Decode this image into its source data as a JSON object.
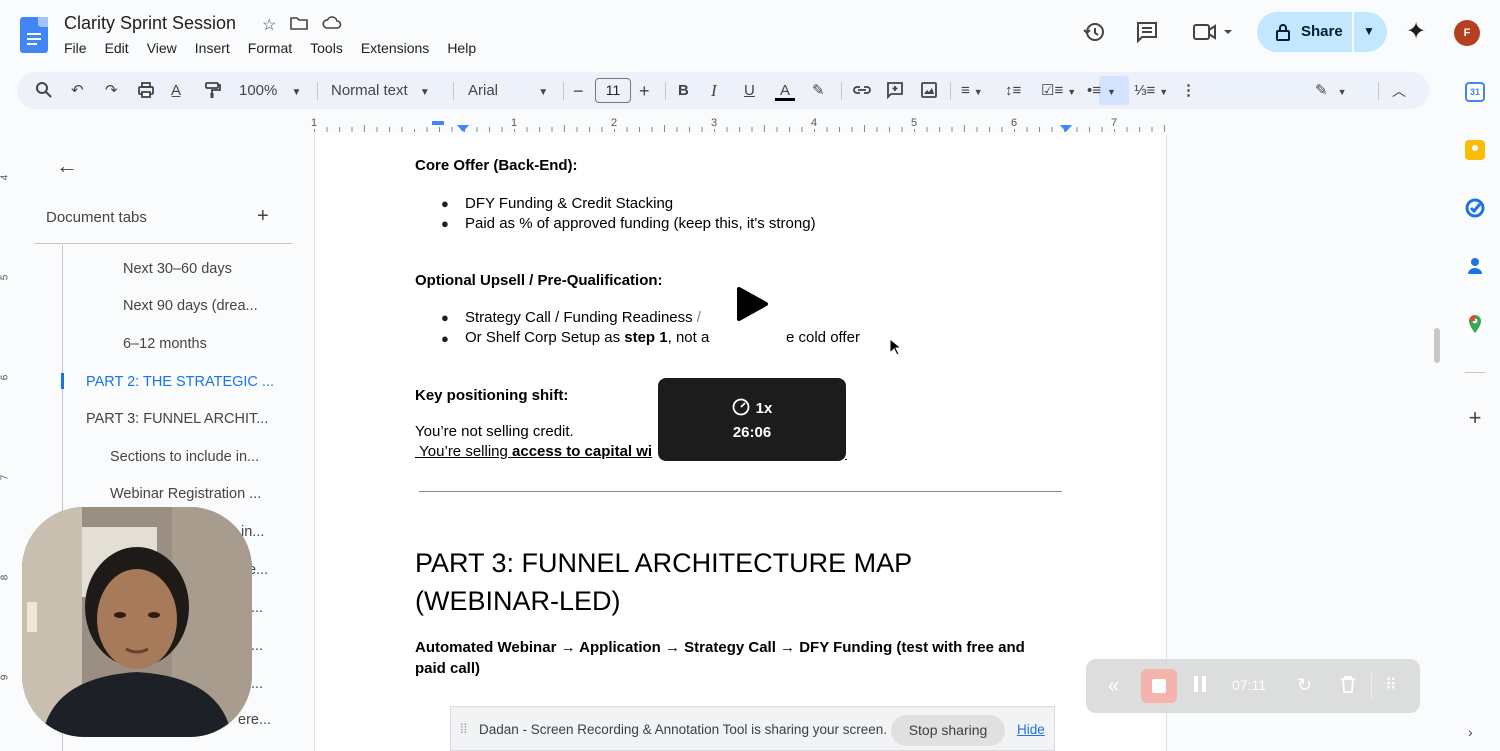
{
  "app": {
    "title": "Clarity Sprint Session",
    "menu": [
      "File",
      "Edit",
      "View",
      "Insert",
      "Format",
      "Tools",
      "Extensions",
      "Help"
    ],
    "share_label": "Share",
    "avatar_initials": "F"
  },
  "toolbar": {
    "zoom": "100%",
    "style": "Normal text",
    "font": "Arial",
    "font_size": "11"
  },
  "ruler": {
    "numbers": [
      "1",
      "1",
      "2",
      "3",
      "4",
      "5",
      "6",
      "7"
    ]
  },
  "left_ruler": {
    "numbers": [
      "4",
      "5",
      "6",
      "7",
      "8",
      "9"
    ]
  },
  "sidebar": {
    "header": "Document tabs",
    "items": [
      {
        "label": "Next 30–60 days",
        "level": 2
      },
      {
        "label": "Next 90 days (drea...",
        "level": 2
      },
      {
        "label": "6–12 months",
        "level": 2
      },
      {
        "label": "PART 2: THE STRATEGIC ...",
        "level": 1,
        "active": true
      },
      {
        "label": "PART 3: FUNNEL ARCHIT...",
        "level": 1
      },
      {
        "label": "Sections to include in...",
        "level": 2
      },
      {
        "label": "Webinar Registration ...",
        "level": 2
      },
      {
        "label": "in...",
        "level": 2
      },
      {
        "label": "e...",
        "level": 2
      },
      {
        "label": "...",
        "level": 2
      },
      {
        "label": "...",
        "level": 2
      },
      {
        "label": "...",
        "level": 2
      },
      {
        "label": "ere...",
        "level": 2
      }
    ]
  },
  "document": {
    "core_offer_heading": "Core Offer (Back-End):",
    "core_bullets": [
      "DFY Funding & Credit Stacking",
      "Paid as % of approved funding (keep this, it's strong)"
    ],
    "upsell_heading": "Optional Upsell / Pre-Qualification:",
    "upsell_bullet_1": "Strategy Call / Funding Readiness",
    "upsell_bullet_1_tail": "/",
    "upsell_bullet_2_pre": "Or Shelf Corp Setup as ",
    "upsell_bullet_2_bold": "step 1",
    "upsell_bullet_2_mid": ", not a",
    "upsell_bullet_2_end": "e cold offer",
    "positioning_heading": "Key positioning shift:",
    "positioning_line_1": "You’re not selling credit.",
    "positioning_line_2_pre": "You’re selling ",
    "positioning_line_2_bold": "access to capital wi",
    "part3_heading_line1": "PART 3: FUNNEL ARCHITECTURE MAP",
    "part3_heading_line2": "(WEBINAR-LED)",
    "funnel_line_1": "Automated Webinar → Application → Strategy Call → DFY Funding (test with free and",
    "funnel_line_2": "paid call)"
  },
  "player": {
    "speed": "1x",
    "time": "26:06"
  },
  "recorder": {
    "elapsed": "07:11"
  },
  "share_notice": {
    "message": "Dadan - Screen Recording & Annotation Tool is sharing your screen.",
    "stop_label": "Stop sharing",
    "hide_label": "Hide"
  },
  "colors": {
    "accent": "#1a73e8",
    "share_bg": "#c2e7ff",
    "toolbar_bg": "#edf2fa",
    "overlay_bg": "#1c1c1c"
  }
}
